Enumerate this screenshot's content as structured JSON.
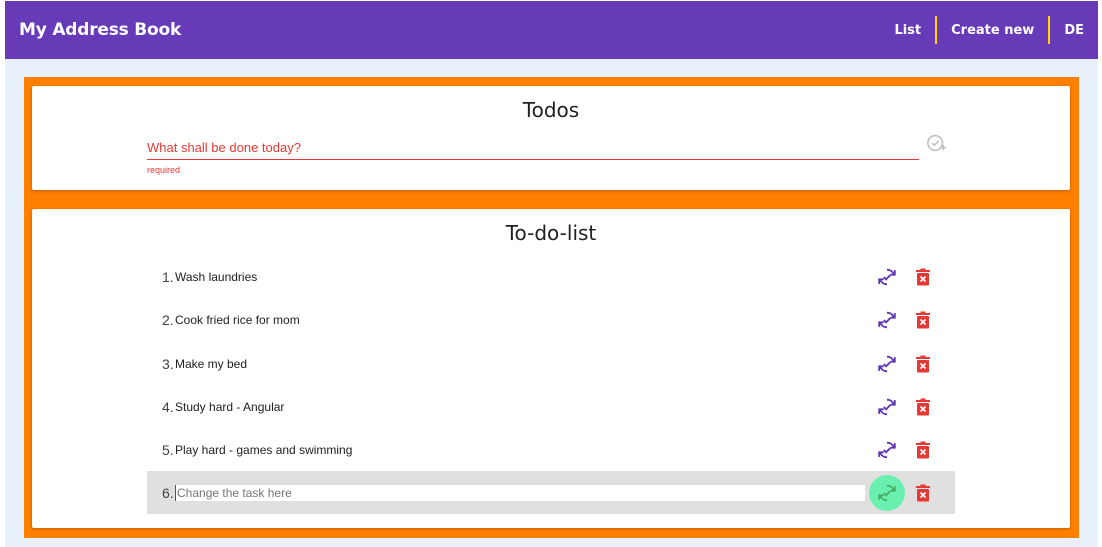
{
  "app": {
    "title": "My Address Book"
  },
  "nav": [
    {
      "label": "List"
    },
    {
      "label": "Create new"
    },
    {
      "label": "DE"
    }
  ],
  "todos": {
    "title": "Todos",
    "placeholder": "What shall be done today?",
    "hint": "required"
  },
  "list": {
    "title": "To-do-list",
    "items": [
      {
        "num": "1.",
        "text": "Wash laundries"
      },
      {
        "num": "2.",
        "text": "Cook fried rice for mom"
      },
      {
        "num": "3.",
        "text": "Make my bed"
      },
      {
        "num": "4.",
        "text": "Study hard - Angular"
      },
      {
        "num": "5.",
        "text": "Play hard - games and swimming"
      }
    ],
    "editing": {
      "num": "6.",
      "placeholder": "Change the task here"
    }
  },
  "colors": {
    "header": "#673ab7",
    "frame": "#ff7f00",
    "error": "#e53935",
    "refresh": "#5e35b1",
    "delete": "#e53935",
    "active": "#69f0ae"
  },
  "icons": {
    "add": "add-task-icon",
    "refresh": "refresh-check-icon",
    "delete": "delete-icon"
  }
}
